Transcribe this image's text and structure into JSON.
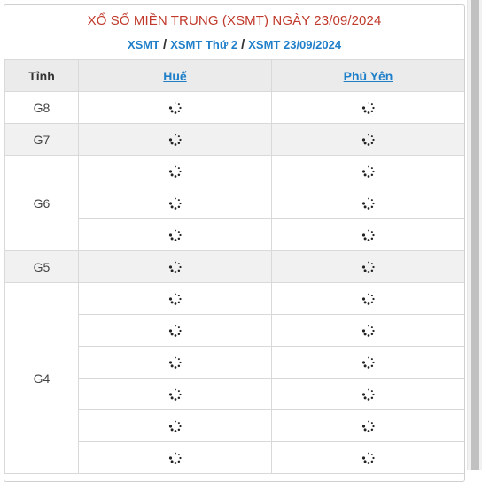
{
  "header": {
    "title": "XỔ SỐ MIỀN TRUNG (XSMT) NGÀY 23/09/2024"
  },
  "breadcrumb": {
    "items": [
      "XSMT",
      "XSMT Thứ 2",
      "XSMT 23/09/2024"
    ],
    "separator": "/"
  },
  "table": {
    "col_label": "Tỉnh",
    "provinces": [
      "Huế",
      "Phú Yên"
    ],
    "prizes": [
      {
        "label": "G8",
        "rows": 1
      },
      {
        "label": "G7",
        "rows": 1
      },
      {
        "label": "G6",
        "rows": 3
      },
      {
        "label": "G5",
        "rows": 1
      },
      {
        "label": "G4",
        "rows": 6
      }
    ],
    "cell_icon": "loading-spinner-icon"
  },
  "colors": {
    "title": "#c0392b",
    "link": "#1f7fc9",
    "header_bg": "#ebebeb",
    "shade_bg": "#f1f1f1"
  }
}
